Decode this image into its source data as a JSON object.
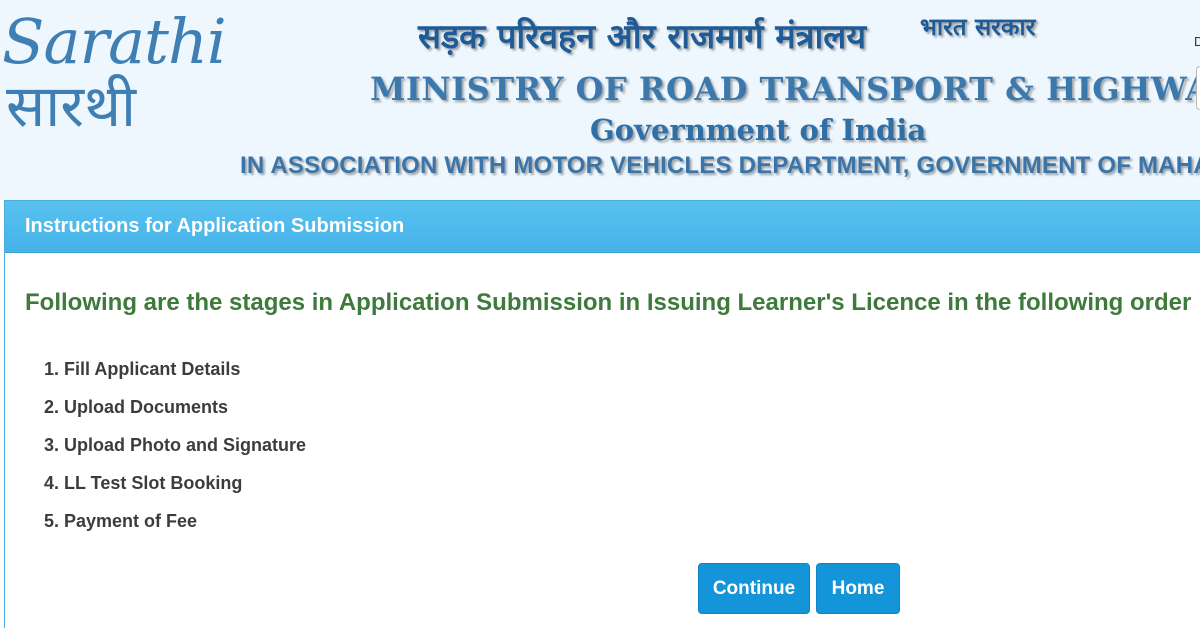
{
  "header": {
    "logo_latin": "Sarathi",
    "logo_deva": "सारथी",
    "title_hindi": "सड़क परिवहन और राजमार्ग मंत्रालय",
    "title_hindi_small": "भारत सरकार",
    "ministry": "MINISTRY OF ROAD TRANSPORT & HIGHWAYS",
    "government": "Government of India",
    "association": "IN ASSOCIATION WITH MOTOR VEHICLES DEPARTMENT, GOVERNMENT OF MAHARASHTRA",
    "edge_char": "D"
  },
  "panel": {
    "title": "Instructions for Application Submission",
    "heading": "Following are the stages in Application Submission in Issuing Learner's Licence in the following order",
    "stages": [
      "1. Fill Applicant Details",
      "2. Upload Documents",
      "3. Upload Photo and Signature",
      "4. LL Test Slot Booking",
      "5. Payment of Fee"
    ],
    "continue_label": "Continue",
    "home_label": "Home"
  },
  "colors": {
    "header_bg": "#eef7fd",
    "panel_head": "#4ab6ea",
    "heading_green": "#3d7a3b",
    "button_blue": "#1494d9",
    "title_blue": "#3a78ae"
  }
}
